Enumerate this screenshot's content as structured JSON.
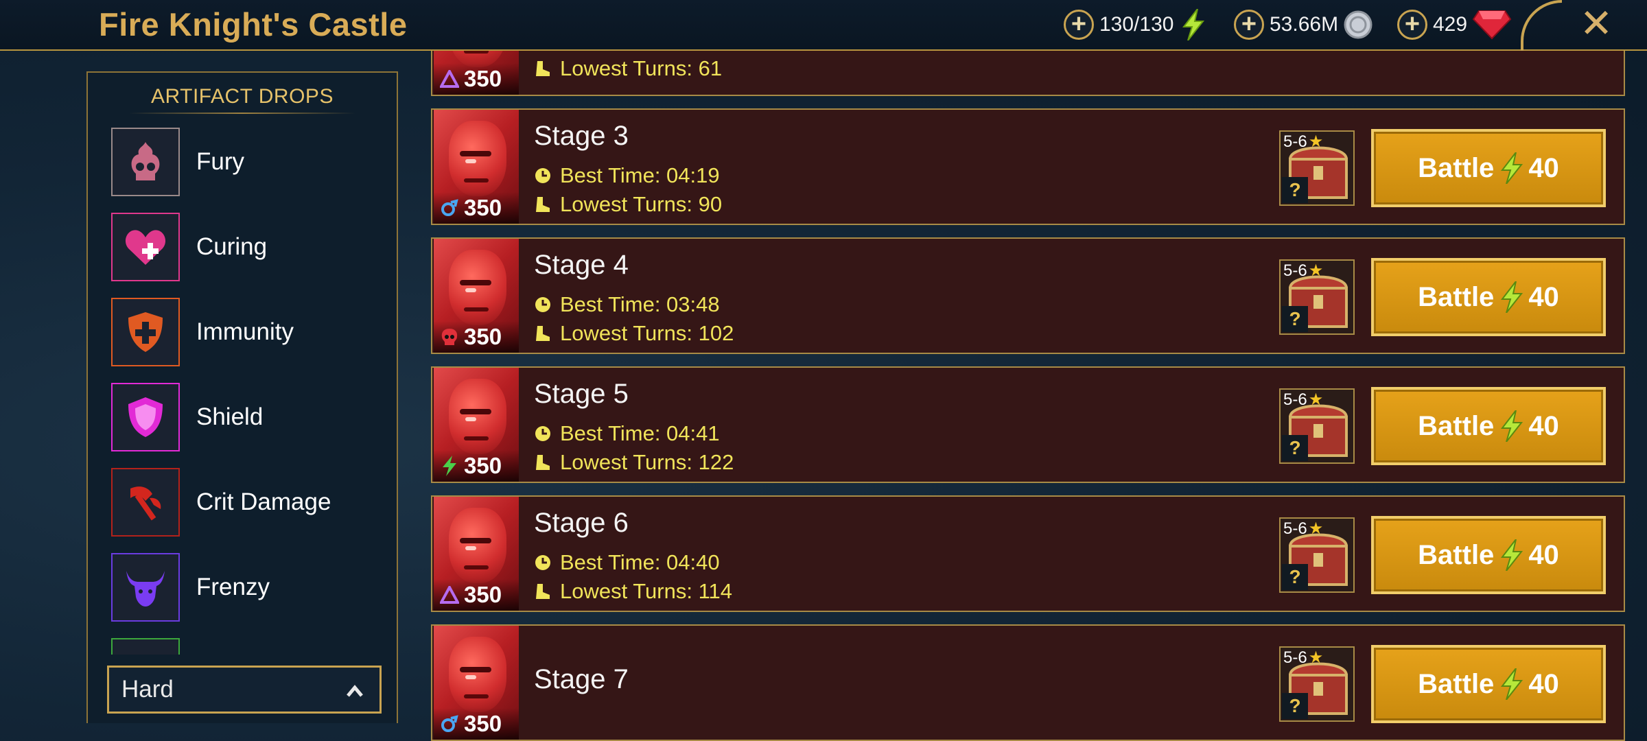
{
  "header": {
    "title": "Fire Knight's Castle",
    "energy": "130/130",
    "silver": "53.66M",
    "gems": "429",
    "energy_icon": "lightning-bolt-icon",
    "silver_icon": "silver-coin-icon",
    "gem_icon": "red-gem-icon",
    "close_icon": "close-icon"
  },
  "artifact_panel": {
    "title": "ARTIFACT DROPS",
    "sets": [
      {
        "name": "Fury",
        "icon": "skull-flame-icon",
        "color": "#c86a86"
      },
      {
        "name": "Curing",
        "icon": "heart-plus-icon",
        "color": "#e0388c"
      },
      {
        "name": "Immunity",
        "icon": "shield-cross-icon",
        "color": "#e05a22"
      },
      {
        "name": "Shield",
        "icon": "shield-icon",
        "color": "#e22ad6"
      },
      {
        "name": "Crit Damage",
        "icon": "axe-icon",
        "color": "#d3261e"
      },
      {
        "name": "Frenzy",
        "icon": "bull-head-icon",
        "color": "#7a3cf2"
      }
    ],
    "difficulty": "Hard"
  },
  "stages": [
    {
      "name": "",
      "level": "350",
      "affinity": "magic-triangle-icon",
      "best_time": "",
      "lowest_turns": "Lowest Turns: 61",
      "rank": "",
      "energy": ""
    },
    {
      "name": "Stage 3",
      "level": "350",
      "affinity": "spirit-swirl-icon",
      "best_time": "Best Time: 04:19",
      "lowest_turns": "Lowest Turns: 90",
      "rank": "5-6",
      "battle_label": "Battle",
      "energy": "40"
    },
    {
      "name": "Stage 4",
      "level": "350",
      "affinity": "void-skull-icon",
      "best_time": "Best Time: 03:48",
      "lowest_turns": "Lowest Turns: 102",
      "rank": "5-6",
      "battle_label": "Battle",
      "energy": "40"
    },
    {
      "name": "Stage 5",
      "level": "350",
      "affinity": "force-bolt-icon",
      "best_time": "Best Time: 04:41",
      "lowest_turns": "Lowest Turns: 122",
      "rank": "5-6",
      "battle_label": "Battle",
      "energy": "40"
    },
    {
      "name": "Stage 6",
      "level": "350",
      "affinity": "magic-triangle-icon",
      "best_time": "Best Time: 04:40",
      "lowest_turns": "Lowest Turns: 114",
      "rank": "5-6",
      "battle_label": "Battle",
      "energy": "40"
    },
    {
      "name": "Stage 7",
      "level": "350",
      "affinity": "spirit-swirl-icon",
      "best_time": "",
      "lowest_turns": "",
      "rank": "5-6",
      "battle_label": "Battle",
      "energy": "40"
    }
  ]
}
